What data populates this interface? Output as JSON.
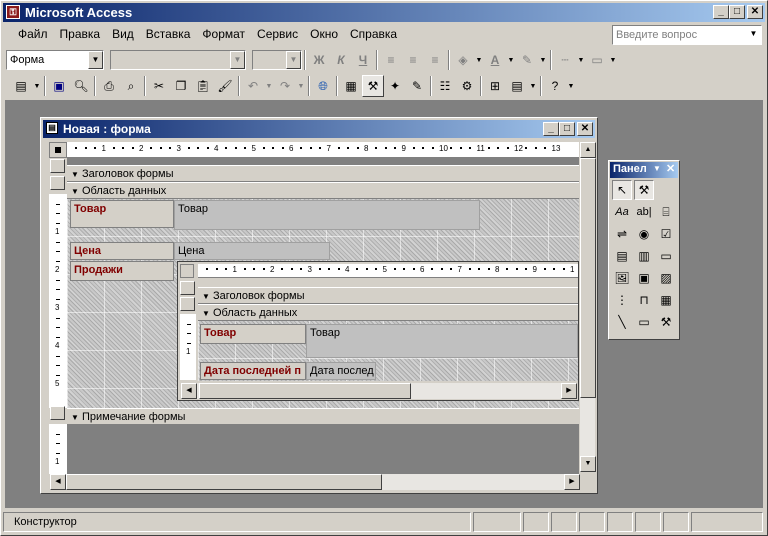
{
  "app": {
    "title": "Microsoft Access",
    "icon": "access-key-icon"
  },
  "menu": [
    "Файл",
    "Правка",
    "Вид",
    "Вставка",
    "Формат",
    "Сервис",
    "Окно",
    "Справка"
  ],
  "help_box": {
    "placeholder": "Введите вопрос"
  },
  "format_toolbar": {
    "object_combo": "Форма",
    "bold": "Ж",
    "italic": "К",
    "underline": "Ч",
    "font_color": "A"
  },
  "form_window": {
    "title": "Новая : форма",
    "ruler_numbers": [
      "1",
      "2",
      "3",
      "4",
      "5",
      "6",
      "7",
      "8",
      "9",
      "10",
      "11",
      "12",
      "13"
    ],
    "v_ruler": [
      "1",
      "2",
      "3",
      "4",
      "5"
    ],
    "header_section": "Заголовок формы",
    "detail_section": "Область данных",
    "footer_section": "Примечание формы",
    "fields": [
      {
        "label": "Товар",
        "value": "Товар"
      },
      {
        "label": "Цена",
        "value": "Цена"
      },
      {
        "label": "Продажи",
        "value": ""
      }
    ],
    "footer_ruler": [
      "1"
    ]
  },
  "subform": {
    "ruler_numbers": [
      "1",
      "2",
      "3",
      "4",
      "5",
      "6",
      "7",
      "8",
      "9",
      "1"
    ],
    "v_ruler": [
      "1"
    ],
    "header_section": "Заголовок формы",
    "detail_section": "Область данных",
    "fields": [
      {
        "label": "Товар",
        "value": "Товар"
      },
      {
        "label": "Дата последней п",
        "value": "Дата послед"
      }
    ]
  },
  "toolbox": {
    "title": "Панел",
    "text_label_glyph": "Aa",
    "textbox_glyph": "ab|"
  },
  "status": {
    "mode": "Конструктор"
  }
}
